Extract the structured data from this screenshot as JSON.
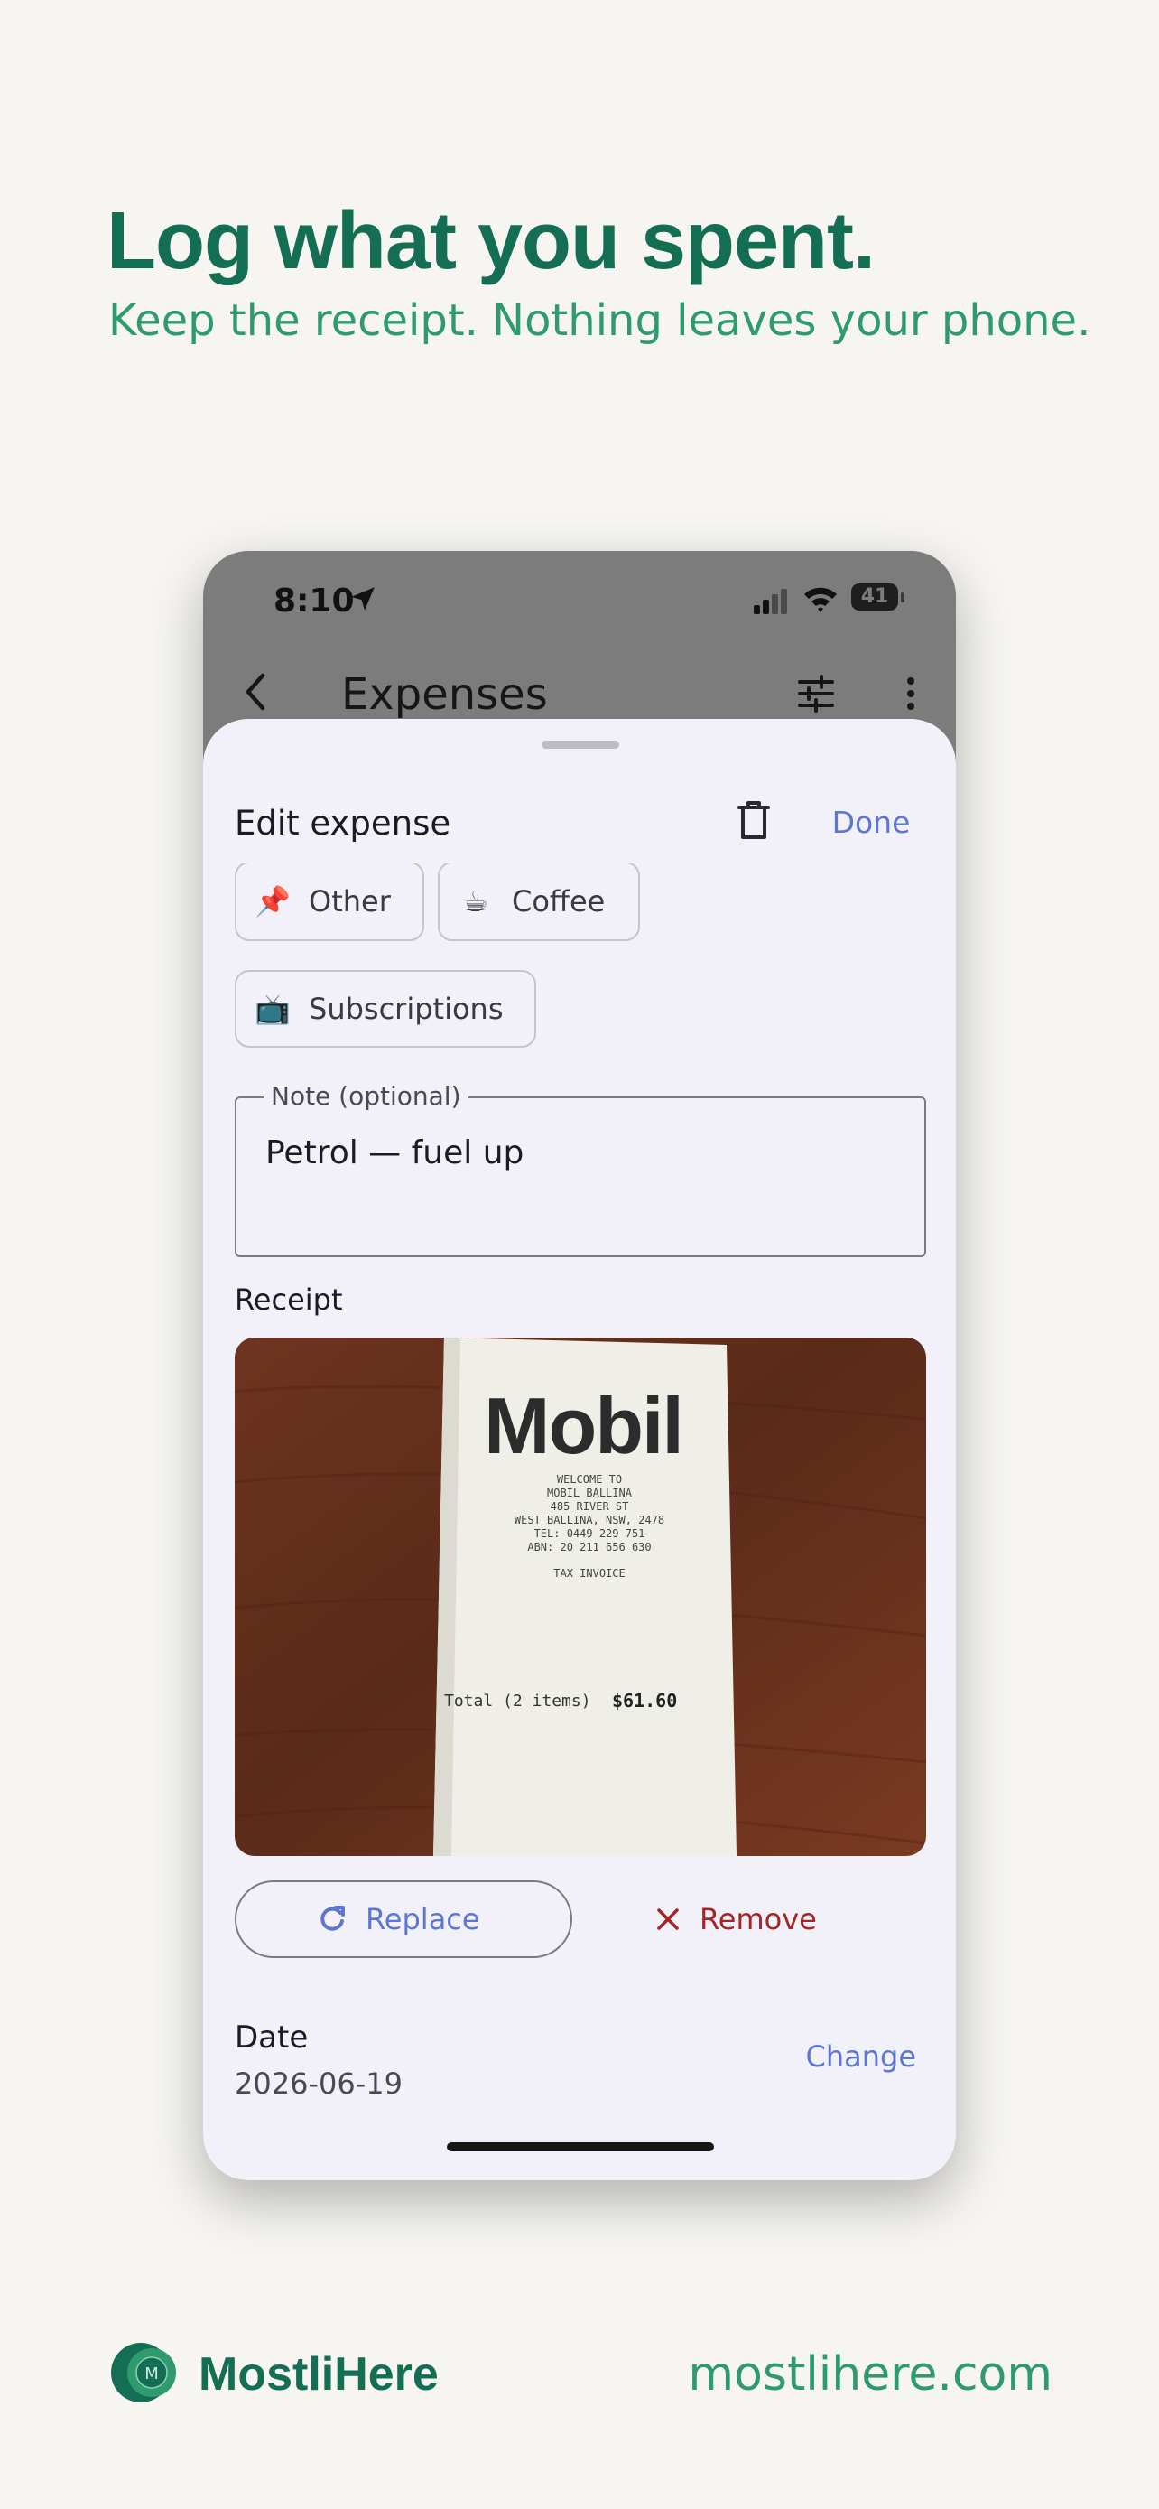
{
  "marketing": {
    "headline": "Log what you spent.",
    "subheadline": "Keep the receipt. Nothing leaves your phone."
  },
  "status_bar": {
    "time": "8:10",
    "battery": "41"
  },
  "app_bar": {
    "title": "Expenses",
    "icons": [
      "back-icon",
      "tune-icon",
      "more-vert-icon"
    ]
  },
  "sheet": {
    "title": "Edit expense",
    "done_label": "Done",
    "categories": [
      {
        "emoji": "📌",
        "label": "Other"
      },
      {
        "emoji": "☕",
        "label": "Coffee"
      },
      {
        "emoji": "📺",
        "label": "Subscriptions"
      }
    ],
    "note": {
      "label": "Note (optional)",
      "value": "Petrol — fuel up"
    },
    "receipt_label": "Receipt",
    "receipt": {
      "brand": "Mobil",
      "lines": [
        "WELCOME TO",
        "MOBIL BALLINA",
        "485 RIVER ST",
        "WEST BALLINA, NSW, 2478",
        "TEL: 0449 229 751",
        "ABN: 20 211 656 630",
        "TAX INVOICE"
      ],
      "total_label": "Total (2 items)",
      "total_value": "$61.60"
    },
    "replace_label": "Replace",
    "remove_label": "Remove",
    "date_label": "Date",
    "date_value": "2026-06-19",
    "change_label": "Change"
  },
  "brand": {
    "name": "MostliHere",
    "url": "mostlihere.com",
    "logo_letter": "M"
  },
  "colors": {
    "primary_green": "#146e54",
    "accent_green": "#2f9a6e",
    "link_blue": "#5d76cf",
    "danger_red": "#a42525"
  }
}
